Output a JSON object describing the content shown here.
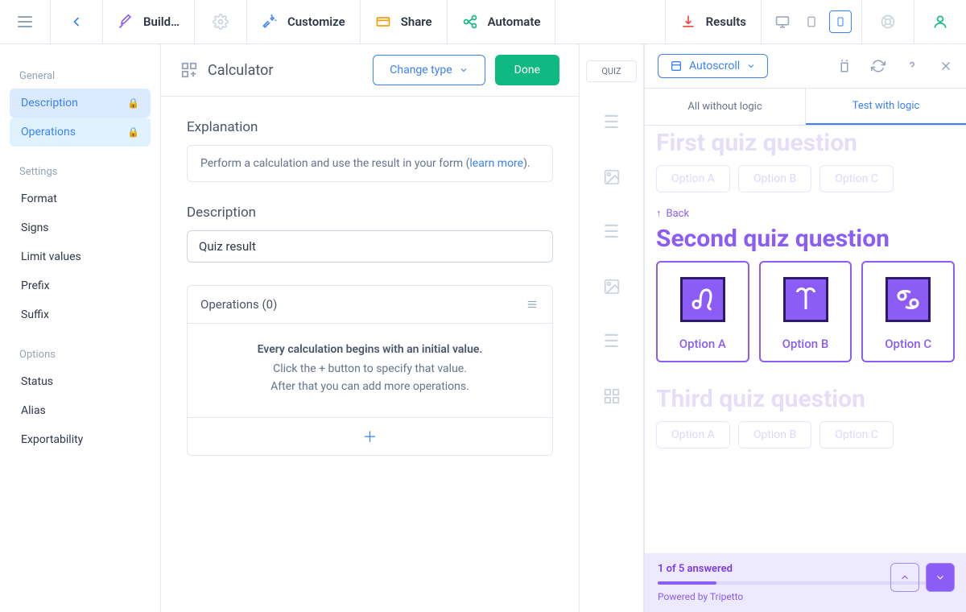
{
  "topbar": {
    "build": "Build…",
    "customize": "Customize",
    "share": "Share",
    "automate": "Automate",
    "results": "Results"
  },
  "header": {
    "title": "Calculator",
    "change_type": "Change type",
    "done": "Done"
  },
  "sidebar": {
    "g1": "General",
    "description": "Description",
    "operations": "Operations",
    "g2": "Settings",
    "format": "Format",
    "signs": "Signs",
    "limit": "Limit values",
    "prefix": "Prefix",
    "suffix": "Suffix",
    "g3": "Options",
    "status": "Status",
    "alias": "Alias",
    "export": "Exportability"
  },
  "content": {
    "explain_title": "Explanation",
    "explain_text_pre": "Perform a calculation and use the result in your form (",
    "explain_link": "learn more",
    "explain_text_post": ").",
    "desc_title": "Description",
    "desc_value": "Quiz result",
    "ops_title": "Operations (0)",
    "ops_strong": "Every calculation begins with an initial value.",
    "ops_l1": "Click the + button to specify that value.",
    "ops_l2": "After that you can add more operations."
  },
  "mid": {
    "quiz": "QUIZ"
  },
  "right": {
    "autoscroll": "Autoscroll",
    "tab1": "All without logic",
    "tab2": "Test with logic",
    "q1": "First quiz question",
    "q2": "Second quiz question",
    "q3": "Third quiz question",
    "oA": "Option A",
    "oB": "Option B",
    "oC": "Option C",
    "back": "Back",
    "progress": "1 of 5 answered",
    "powered": "Powered by Tripetto"
  }
}
